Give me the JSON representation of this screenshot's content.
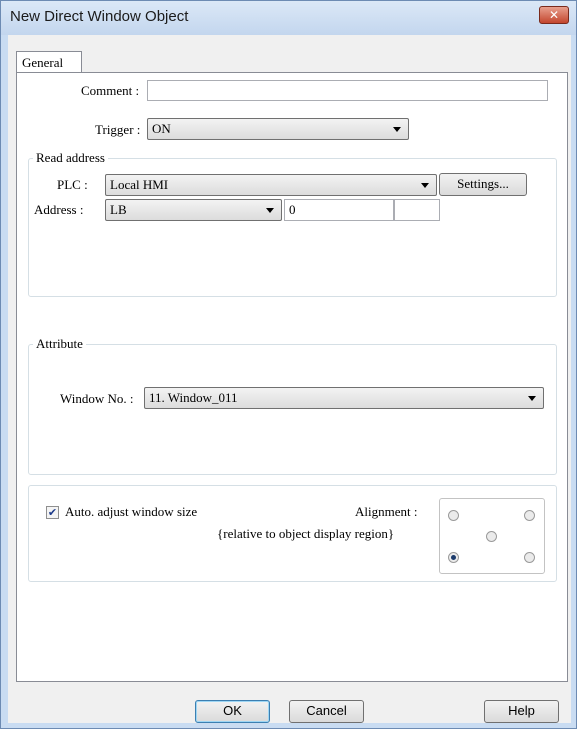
{
  "window": {
    "title": "New Direct Window Object",
    "close_icon": "close-icon"
  },
  "tabs": [
    {
      "label": "General",
      "selected": true
    }
  ],
  "general": {
    "comment_label": "Comment :",
    "comment_value": "",
    "trigger_label": "Trigger :",
    "trigger_value": "ON"
  },
  "read_address": {
    "group_title": "Read address",
    "plc_label": "PLC :",
    "plc_value": "Local HMI",
    "settings_button": "Settings...",
    "address_label": "Address :",
    "address_device": "LB",
    "address_value": "0",
    "address_suffix": ""
  },
  "attribute": {
    "group_title": "Attribute",
    "window_no_label": "Window No. :",
    "window_no_value": "11. Window_011"
  },
  "display": {
    "auto_adjust_label": "Auto. adjust window size",
    "auto_adjust_checked": true,
    "alignment_label": "Alignment :",
    "alignment_note": "{relative to object display region}",
    "alignment_selected": "bottom-left"
  },
  "footer": {
    "ok_label": "OK",
    "cancel_label": "Cancel",
    "help_label": "Help"
  }
}
